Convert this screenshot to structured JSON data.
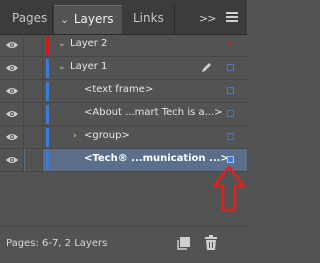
{
  "tabs": {
    "pages": "Pages",
    "layers": "Layers",
    "links": "Links",
    "more": ">>"
  },
  "layers": [
    {
      "label": "Layer 2",
      "type": "layer",
      "expanded": true,
      "color": "#d11a1a",
      "square_color": "#d11a1a"
    },
    {
      "label": "Layer 1",
      "type": "layer",
      "expanded": true,
      "color": "#3e7bd6",
      "square_color": "#3e7bd6",
      "pen": true
    },
    {
      "label": "<text frame>",
      "type": "object",
      "color": "#3e7bd6",
      "square_color": "#3e7bd6"
    },
    {
      "label": "<About ...mart Tech is a...>",
      "type": "object",
      "color": "#3e7bd6",
      "square_color": "#3e7bd6"
    },
    {
      "label": "<group>",
      "type": "group",
      "expanded": false,
      "color": "#3e7bd6",
      "square_color": "#3e7bd6"
    },
    {
      "label": "<Tech® ...munication ...>",
      "type": "object",
      "selected": true,
      "color": "#3e7bd6",
      "square_color": "#3e7bd6"
    }
  ],
  "footer": {
    "status": "Pages: 6-7, 2 Layers"
  },
  "colors": {
    "panel_bg": "#535353",
    "tab_bg": "#3c3c3c",
    "selected_row": "#5b6f8a",
    "annotation_arrow": "#e02020"
  }
}
